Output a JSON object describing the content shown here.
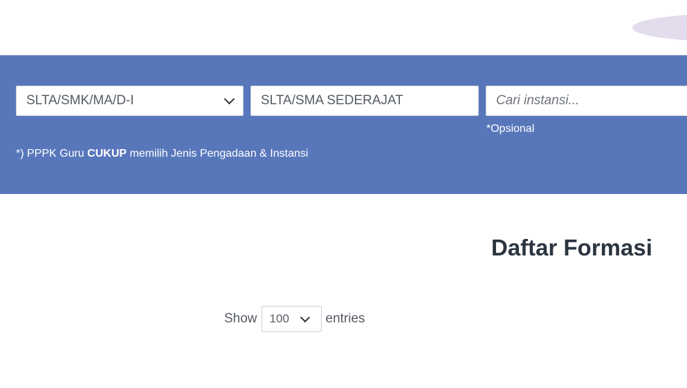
{
  "filters": {
    "education_select": {
      "value": "SLTA/SMK/MA/D-I",
      "icon": "chevron-down-icon"
    },
    "major_field": {
      "value": "SLTA/SMA SEDERAJAT"
    },
    "agency_search": {
      "placeholder": "Cari instansi...",
      "value": ""
    },
    "optional_note": "*Opsional",
    "pppk_note": {
      "prefix": "*) PPPK Guru ",
      "emphasis": "CUKUP",
      "suffix": " memilih Jenis Pengadaan & Instansi"
    }
  },
  "main": {
    "title": "Daftar Formasi",
    "entries_control": {
      "show_label": "Show",
      "selected": "100",
      "entries_label": "entries",
      "icon": "chevron-down-icon"
    }
  },
  "colors": {
    "band": "#5877bb",
    "title_text": "#2b3440",
    "decor_ellipse": "#e2dcec"
  }
}
